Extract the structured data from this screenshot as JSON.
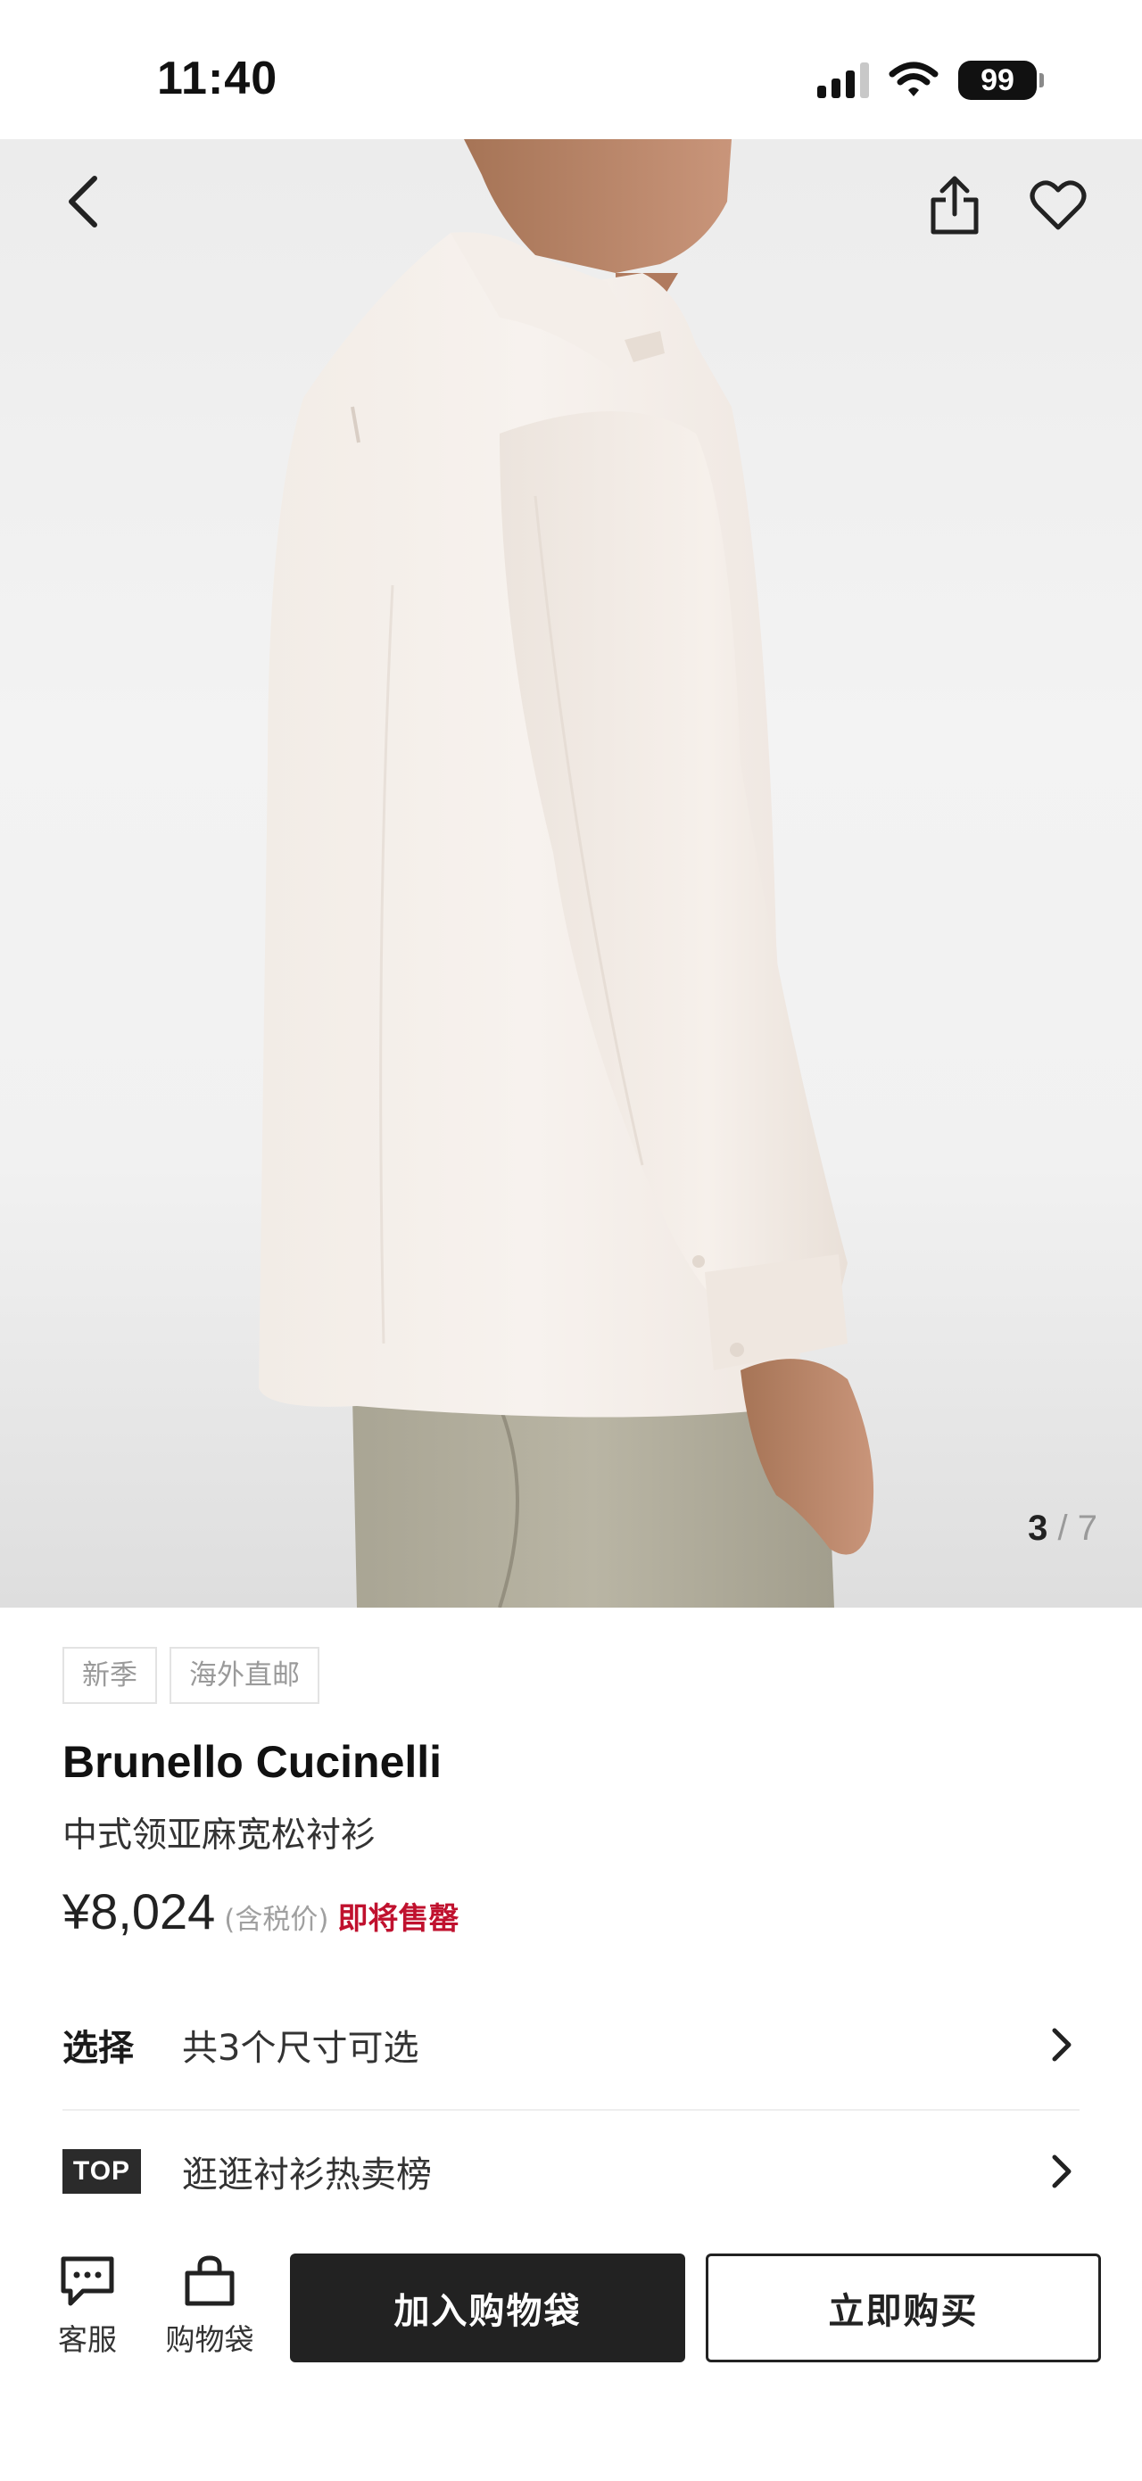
{
  "status_bar": {
    "time": "11:40",
    "battery_level": "99",
    "signal_icon": "cellular-signal-icon",
    "wifi_icon": "wifi-icon"
  },
  "gallery": {
    "current": "3",
    "separator": "/",
    "total": "7",
    "back_icon": "chevron-left-icon",
    "share_icon": "share-icon",
    "favorite_icon": "heart-outline-icon"
  },
  "product": {
    "tags": [
      "新季",
      "海外直邮"
    ],
    "brand": "Brunello Cucinelli",
    "name": "中式领亚麻宽松衬衫",
    "price": "¥8,024",
    "tax_note": "(含税价)",
    "stock_status": "即将售罄"
  },
  "rows": {
    "size_label": "选择",
    "size_text": "共3个尺寸可选",
    "top_badge": "TOP",
    "ranking_text": "逛逛衬衫热卖榜"
  },
  "bottom_bar": {
    "service_label": "客服",
    "bag_label": "购物袋",
    "add_to_bag": "加入购物袋",
    "buy_now": "立即购买"
  },
  "colors": {
    "accent_red": "#c0112e",
    "primary_dark": "#222222",
    "muted_text": "#9a9a9a"
  }
}
